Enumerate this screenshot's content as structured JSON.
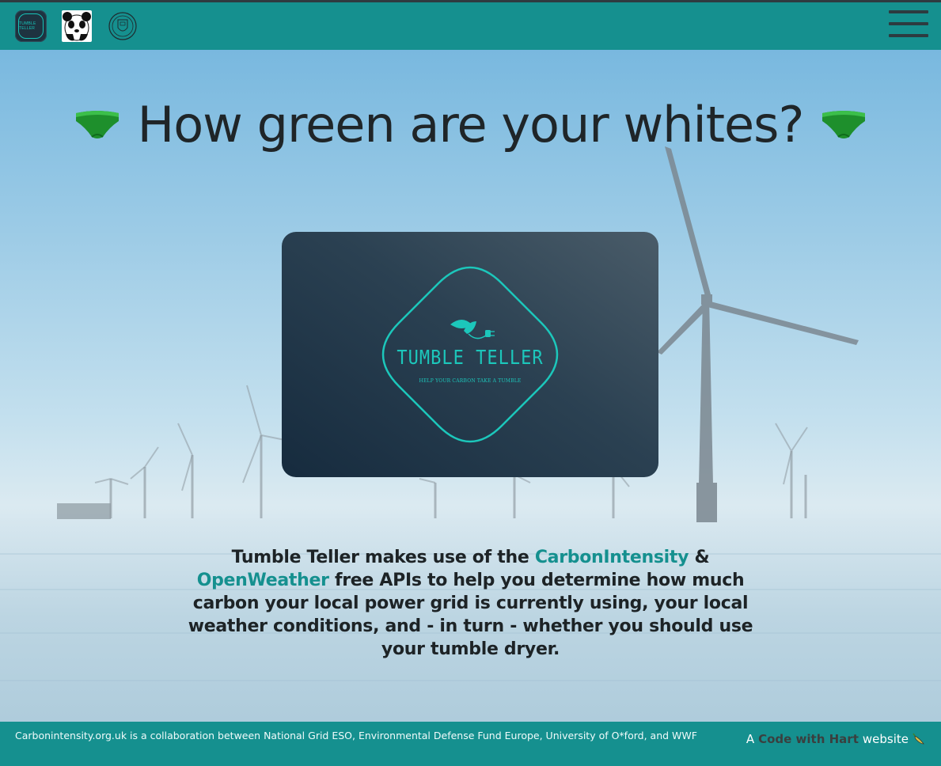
{
  "header": {
    "logos": [
      {
        "name": "tumble-teller-logo",
        "text": "TUMBLE TELLER"
      },
      {
        "name": "wwf-logo"
      },
      {
        "name": "university-of-oxford-logo"
      }
    ],
    "menu_icon": "hamburger-menu-icon"
  },
  "hero": {
    "title": "How green are your whites?",
    "decor_icon": "green-underpants-icon"
  },
  "card": {
    "brand_name": "TUMBLE TELLER",
    "tagline": "HELP YOUR CARBON TAKE A TUMBLE",
    "icon": "leaf-plug-icon"
  },
  "description": {
    "part1": "Tumble Teller makes use of the ",
    "link1": "CarbonIntensity",
    "part2": " & ",
    "link2": "OpenWeather",
    "part3": " free APIs to help you determine how much carbon your local power grid is currently using, your local weather conditions, and - in turn - whether you should use your tumble dryer."
  },
  "footer": {
    "note": "Carbonintensity.org.uk is a collaboration between National Grid ESO, Environmental Defense Fund Europe, University of O*ford, and WWF",
    "credit_prefix": "A ",
    "credit_link": "Code with Hart",
    "credit_suffix": " website",
    "credit_icon": "chili-pepper-icon"
  },
  "colors": {
    "accent": "#15908f",
    "badge": "#1cc7bb",
    "text": "#1d2326"
  }
}
